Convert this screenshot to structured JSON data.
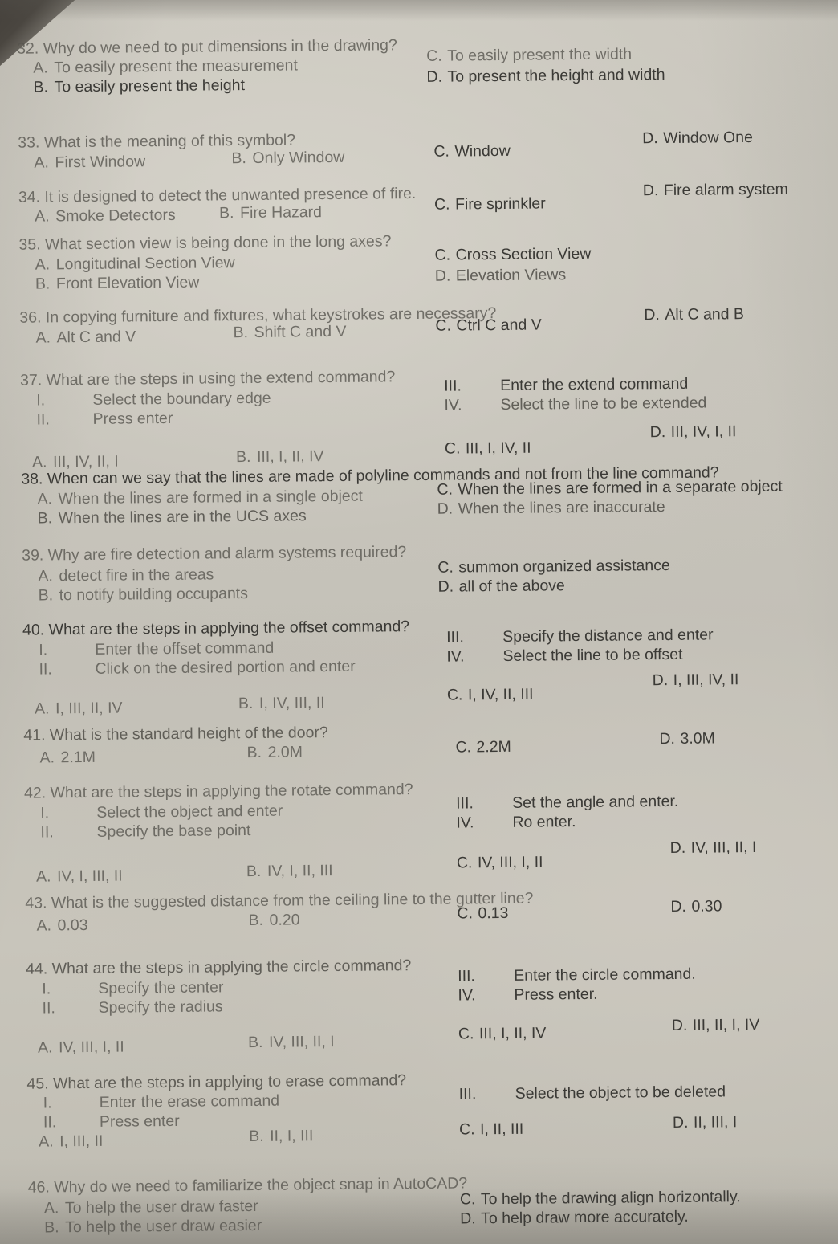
{
  "document": {
    "type": "multiple-choice-exam",
    "subject_hint": "AutoCAD / Building Drafting",
    "question_range": "32-46"
  },
  "questions": [
    {
      "number": "32.",
      "stem": "Why do we need to put dimensions in the drawing?",
      "options": [
        {
          "label": "A.",
          "text": "To easily present the measurement"
        },
        {
          "label": "B.",
          "text": "To easily present the height"
        },
        {
          "label": "C.",
          "text": "To easily present the width"
        },
        {
          "label": "D.",
          "text": "To present the height and width"
        }
      ]
    },
    {
      "number": "33.",
      "stem": "What is the meaning of this symbol?",
      "options": [
        {
          "label": "A.",
          "text": "First Window"
        },
        {
          "label": "B.",
          "text": "Only Window"
        },
        {
          "label": "C.",
          "text": "Window"
        },
        {
          "label": "D.",
          "text": "Window One"
        }
      ]
    },
    {
      "number": "34.",
      "stem": "It is designed to detect the unwanted presence of fire.",
      "options": [
        {
          "label": "A.",
          "text": "Smoke Detectors"
        },
        {
          "label": "B.",
          "text": "Fire Hazard"
        },
        {
          "label": "C.",
          "text": "Fire sprinkler"
        },
        {
          "label": "D.",
          "text": "Fire alarm system"
        }
      ]
    },
    {
      "number": "35.",
      "stem": "What section view is being done in the long axes?",
      "options": [
        {
          "label": "A.",
          "text": "Longitudinal Section View"
        },
        {
          "label": "B.",
          "text": "Front Elevation View"
        },
        {
          "label": "C.",
          "text": "Cross Section View"
        },
        {
          "label": "D.",
          "text": "Elevation Views"
        }
      ]
    },
    {
      "number": "36.",
      "stem": "In copying furniture and fixtures, what keystrokes are necessary?",
      "options": [
        {
          "label": "A.",
          "text": "Alt C and V"
        },
        {
          "label": "B.",
          "text": "Shift C and V"
        },
        {
          "label": "C.",
          "text": "Ctrl C and V"
        },
        {
          "label": "D.",
          "text": "Alt C and B"
        }
      ]
    },
    {
      "number": "37.",
      "stem": "What are the steps in using the extend command?",
      "steps": [
        {
          "numeral": "I.",
          "text": "Select the boundary edge"
        },
        {
          "numeral": "II.",
          "text": "Press enter"
        },
        {
          "numeral": "III.",
          "text": "Enter the extend command"
        },
        {
          "numeral": "IV.",
          "text": "Select the line to be extended"
        }
      ],
      "options": [
        {
          "label": "A.",
          "text": "III, IV, II, I"
        },
        {
          "label": "B.",
          "text": "III, I, II, IV"
        },
        {
          "label": "C.",
          "text": "III, I, IV, II"
        },
        {
          "label": "D.",
          "text": "III, IV, I, II"
        }
      ]
    },
    {
      "number": "38.",
      "stem": "When can we say that the lines are made of polyline commands and not from the line command?",
      "options": [
        {
          "label": "A.",
          "text": "When the lines are formed in a single object"
        },
        {
          "label": "B.",
          "text": "When the lines are in the UCS axes"
        },
        {
          "label": "C.",
          "text": "When the lines are formed in a separate object"
        },
        {
          "label": "D.",
          "text": "When the lines are inaccurate"
        }
      ]
    },
    {
      "number": "39.",
      "stem": "Why are fire detection and alarm systems required?",
      "options": [
        {
          "label": "A.",
          "text": "detect fire in the areas"
        },
        {
          "label": "B.",
          "text": "to notify building occupants"
        },
        {
          "label": "C.",
          "text": "summon organized assistance"
        },
        {
          "label": "D.",
          "text": "all of the above"
        }
      ]
    },
    {
      "number": "40.",
      "stem": "What are the steps in applying the offset command?",
      "steps": [
        {
          "numeral": "I.",
          "text": "Enter the offset command"
        },
        {
          "numeral": "II.",
          "text": "Click on the desired portion and enter"
        },
        {
          "numeral": "III.",
          "text": "Specify the distance and enter"
        },
        {
          "numeral": "IV.",
          "text": "Select the line to be offset"
        }
      ],
      "options": [
        {
          "label": "A.",
          "text": "I, III, II, IV"
        },
        {
          "label": "B.",
          "text": "I, IV, III, II"
        },
        {
          "label": "C.",
          "text": "I, IV, II, III"
        },
        {
          "label": "D.",
          "text": "I, III, IV, II"
        }
      ]
    },
    {
      "number": "41.",
      "stem": "What is the standard height of the door?",
      "options": [
        {
          "label": "A.",
          "text": "2.1M"
        },
        {
          "label": "B.",
          "text": "2.0M"
        },
        {
          "label": "C.",
          "text": "2.2M"
        },
        {
          "label": "D.",
          "text": "3.0M"
        }
      ]
    },
    {
      "number": "42.",
      "stem": "What are the steps in applying the rotate command?",
      "steps": [
        {
          "numeral": "I.",
          "text": "Select the object and enter"
        },
        {
          "numeral": "II.",
          "text": "Specify the base point"
        },
        {
          "numeral": "III.",
          "text": "Set the angle and enter."
        },
        {
          "numeral": "IV.",
          "text": "Ro enter."
        }
      ],
      "options": [
        {
          "label": "A.",
          "text": "IV, I, III, II"
        },
        {
          "label": "B.",
          "text": "IV, I, II, III"
        },
        {
          "label": "C.",
          "text": "IV, III, I, II"
        },
        {
          "label": "D.",
          "text": "IV, III, II, I"
        }
      ]
    },
    {
      "number": "43.",
      "stem": "What is the suggested distance from the ceiling line to the gutter line?",
      "options": [
        {
          "label": "A.",
          "text": "0.03"
        },
        {
          "label": "B.",
          "text": "0.20"
        },
        {
          "label": "C.",
          "text": "0.13"
        },
        {
          "label": "D.",
          "text": "0.30"
        }
      ]
    },
    {
      "number": "44.",
      "stem": "What are the steps in applying the circle command?",
      "steps": [
        {
          "numeral": "I.",
          "text": "Specify the center"
        },
        {
          "numeral": "II.",
          "text": "Specify the radius"
        },
        {
          "numeral": "III.",
          "text": "Enter the circle command."
        },
        {
          "numeral": "IV.",
          "text": "Press enter."
        }
      ],
      "options": [
        {
          "label": "A.",
          "text": "IV, III, I, II"
        },
        {
          "label": "B.",
          "text": "IV, III, II, I"
        },
        {
          "label": "C.",
          "text": "III, I, II, IV"
        },
        {
          "label": "D.",
          "text": "III, II, I, IV"
        }
      ]
    },
    {
      "number": "45.",
      "stem": "What are the steps in applying to erase command?",
      "steps": [
        {
          "numeral": "I.",
          "text": "Enter the erase command"
        },
        {
          "numeral": "II.",
          "text": "Press enter"
        },
        {
          "numeral": "III.",
          "text": "Select the object to be deleted"
        }
      ],
      "options": [
        {
          "label": "A.",
          "text": "I, III, II"
        },
        {
          "label": "B.",
          "text": "II, I, III"
        },
        {
          "label": "C.",
          "text": "I, II, III"
        },
        {
          "label": "D.",
          "text": "II, III, I"
        }
      ]
    },
    {
      "number": "46.",
      "stem": "Why do we need to familiarize the object snap in AutoCAD?",
      "options": [
        {
          "label": "A.",
          "text": "To help the user draw faster"
        },
        {
          "label": "B.",
          "text": "To help the user draw easier"
        },
        {
          "label": "C.",
          "text": "To help the drawing align horizontally."
        },
        {
          "label": "D.",
          "text": "To help draw more accurately."
        }
      ]
    }
  ]
}
